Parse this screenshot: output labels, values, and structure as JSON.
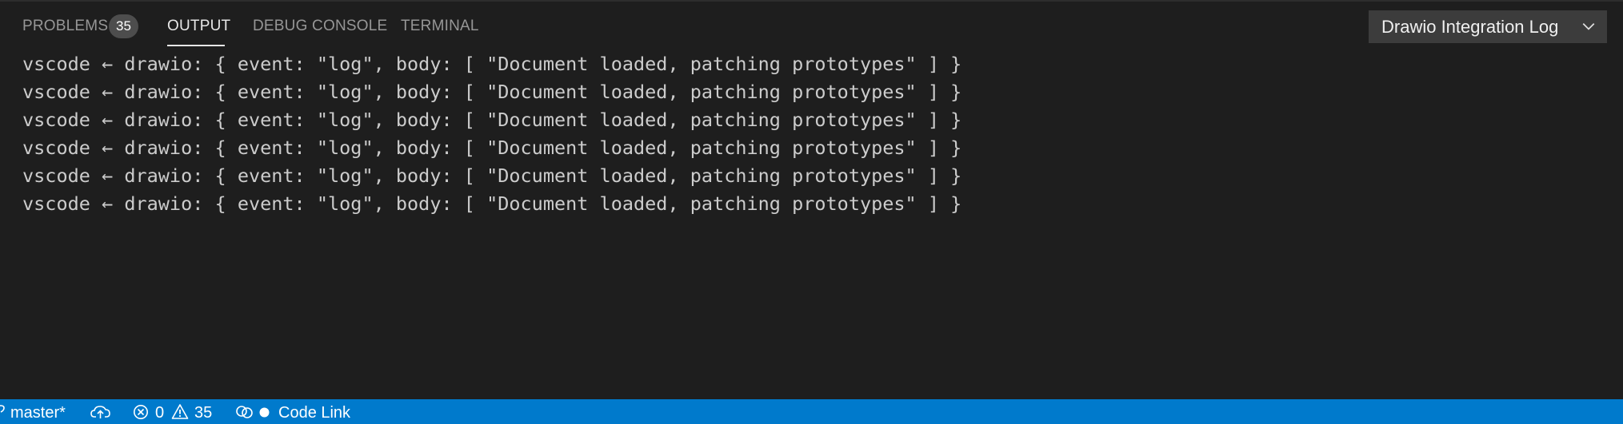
{
  "panel": {
    "tabs": [
      {
        "label": "PROBLEMS",
        "badge": "35"
      },
      {
        "label": "OUTPUT",
        "active": true
      },
      {
        "label": "DEBUG CONSOLE"
      },
      {
        "label": "TERMINAL"
      }
    ],
    "channel_select": {
      "value": "Drawio Integration Log",
      "icon": "chevron-down-icon"
    }
  },
  "output": {
    "lines": [
      "vscode ← drawio: { event: \"log\", body: [ \"Document loaded, patching prototypes\" ] }",
      "vscode ← drawio: { event: \"log\", body: [ \"Document loaded, patching prototypes\" ] }",
      "vscode ← drawio: { event: \"log\", body: [ \"Document loaded, patching prototypes\" ] }",
      "vscode ← drawio: { event: \"log\", body: [ \"Document loaded, patching prototypes\" ] }",
      "vscode ← drawio: { event: \"log\", body: [ \"Document loaded, patching prototypes\" ] }",
      "vscode ← drawio: { event: \"log\", body: [ \"Document loaded, patching prototypes\" ] }"
    ]
  },
  "statusbar": {
    "branch": "master*",
    "errors": "0",
    "warnings": "35",
    "live_share": "Code Link",
    "icons": [
      "branch-icon",
      "cloud-sync-icon",
      "error-icon",
      "warning-icon",
      "link-icon",
      "dot-icon"
    ]
  },
  "colors": {
    "background": "#1e1e1e",
    "statusbar": "#007acc",
    "text": "#cccccc",
    "tab_inactive": "#969696",
    "tab_active": "#e7e7e7"
  }
}
